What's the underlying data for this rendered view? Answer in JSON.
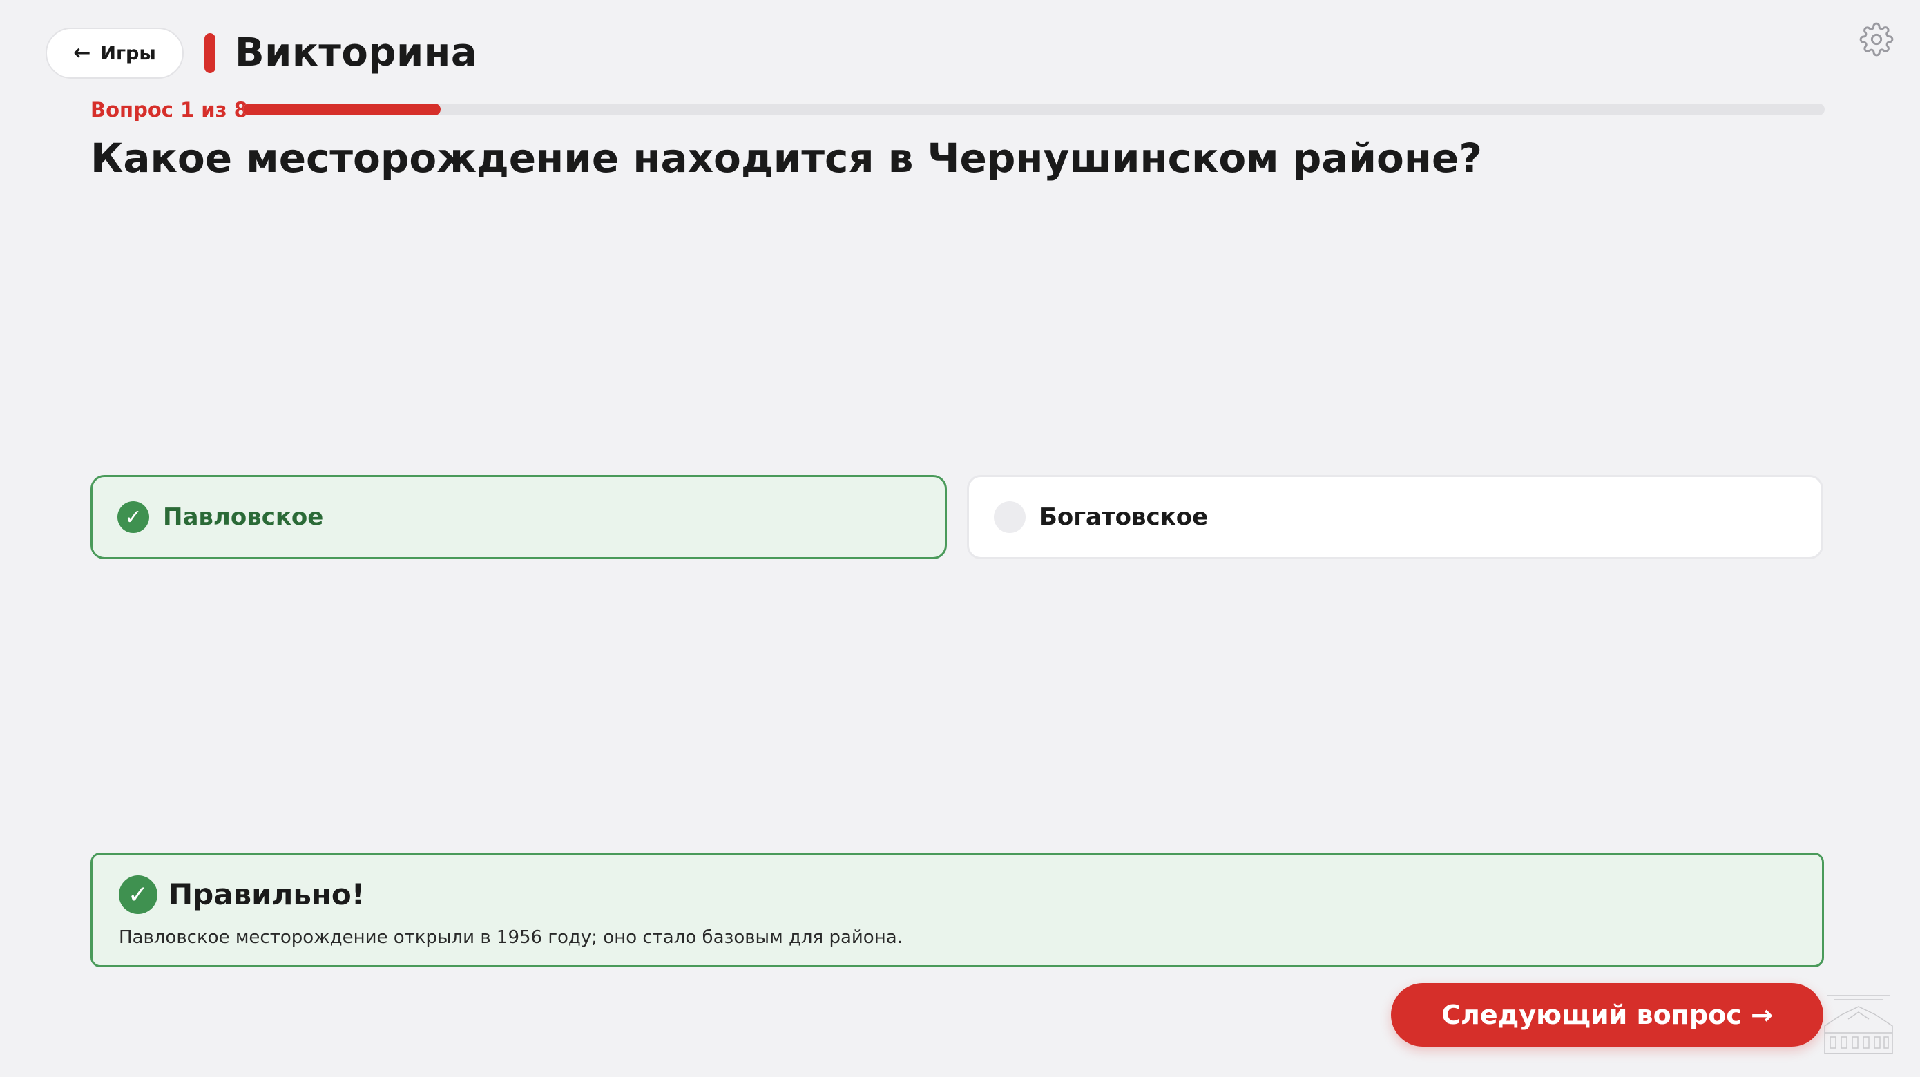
{
  "header": {
    "back_label": "Игры",
    "back_arrow": "←",
    "title": "Викторина",
    "settings_icon": "gear-icon"
  },
  "progress": {
    "counter_text": "Вопрос 1 из 8",
    "current": 1,
    "total": 8,
    "fraction": 0.125
  },
  "question": {
    "text": "Какое месторождение находится в Чернушинском районе?"
  },
  "options": [
    {
      "label": "Павловское",
      "state": "correct",
      "icon": "check-icon"
    },
    {
      "label": "Богатовское",
      "state": "unselected",
      "icon": "radio-icon"
    }
  ],
  "feedback": {
    "title": "Правильно!",
    "text": "Павловское месторождение открыли в 1956 году; оно стало базовым для района.",
    "icon": "check-icon"
  },
  "next_button": {
    "label": "Следующий вопрос →"
  },
  "colors": {
    "accent": "#d62f2a",
    "correct_border": "#4a9a5a",
    "correct_bg": "#eaf4ec",
    "background": "#f2f2f4"
  }
}
